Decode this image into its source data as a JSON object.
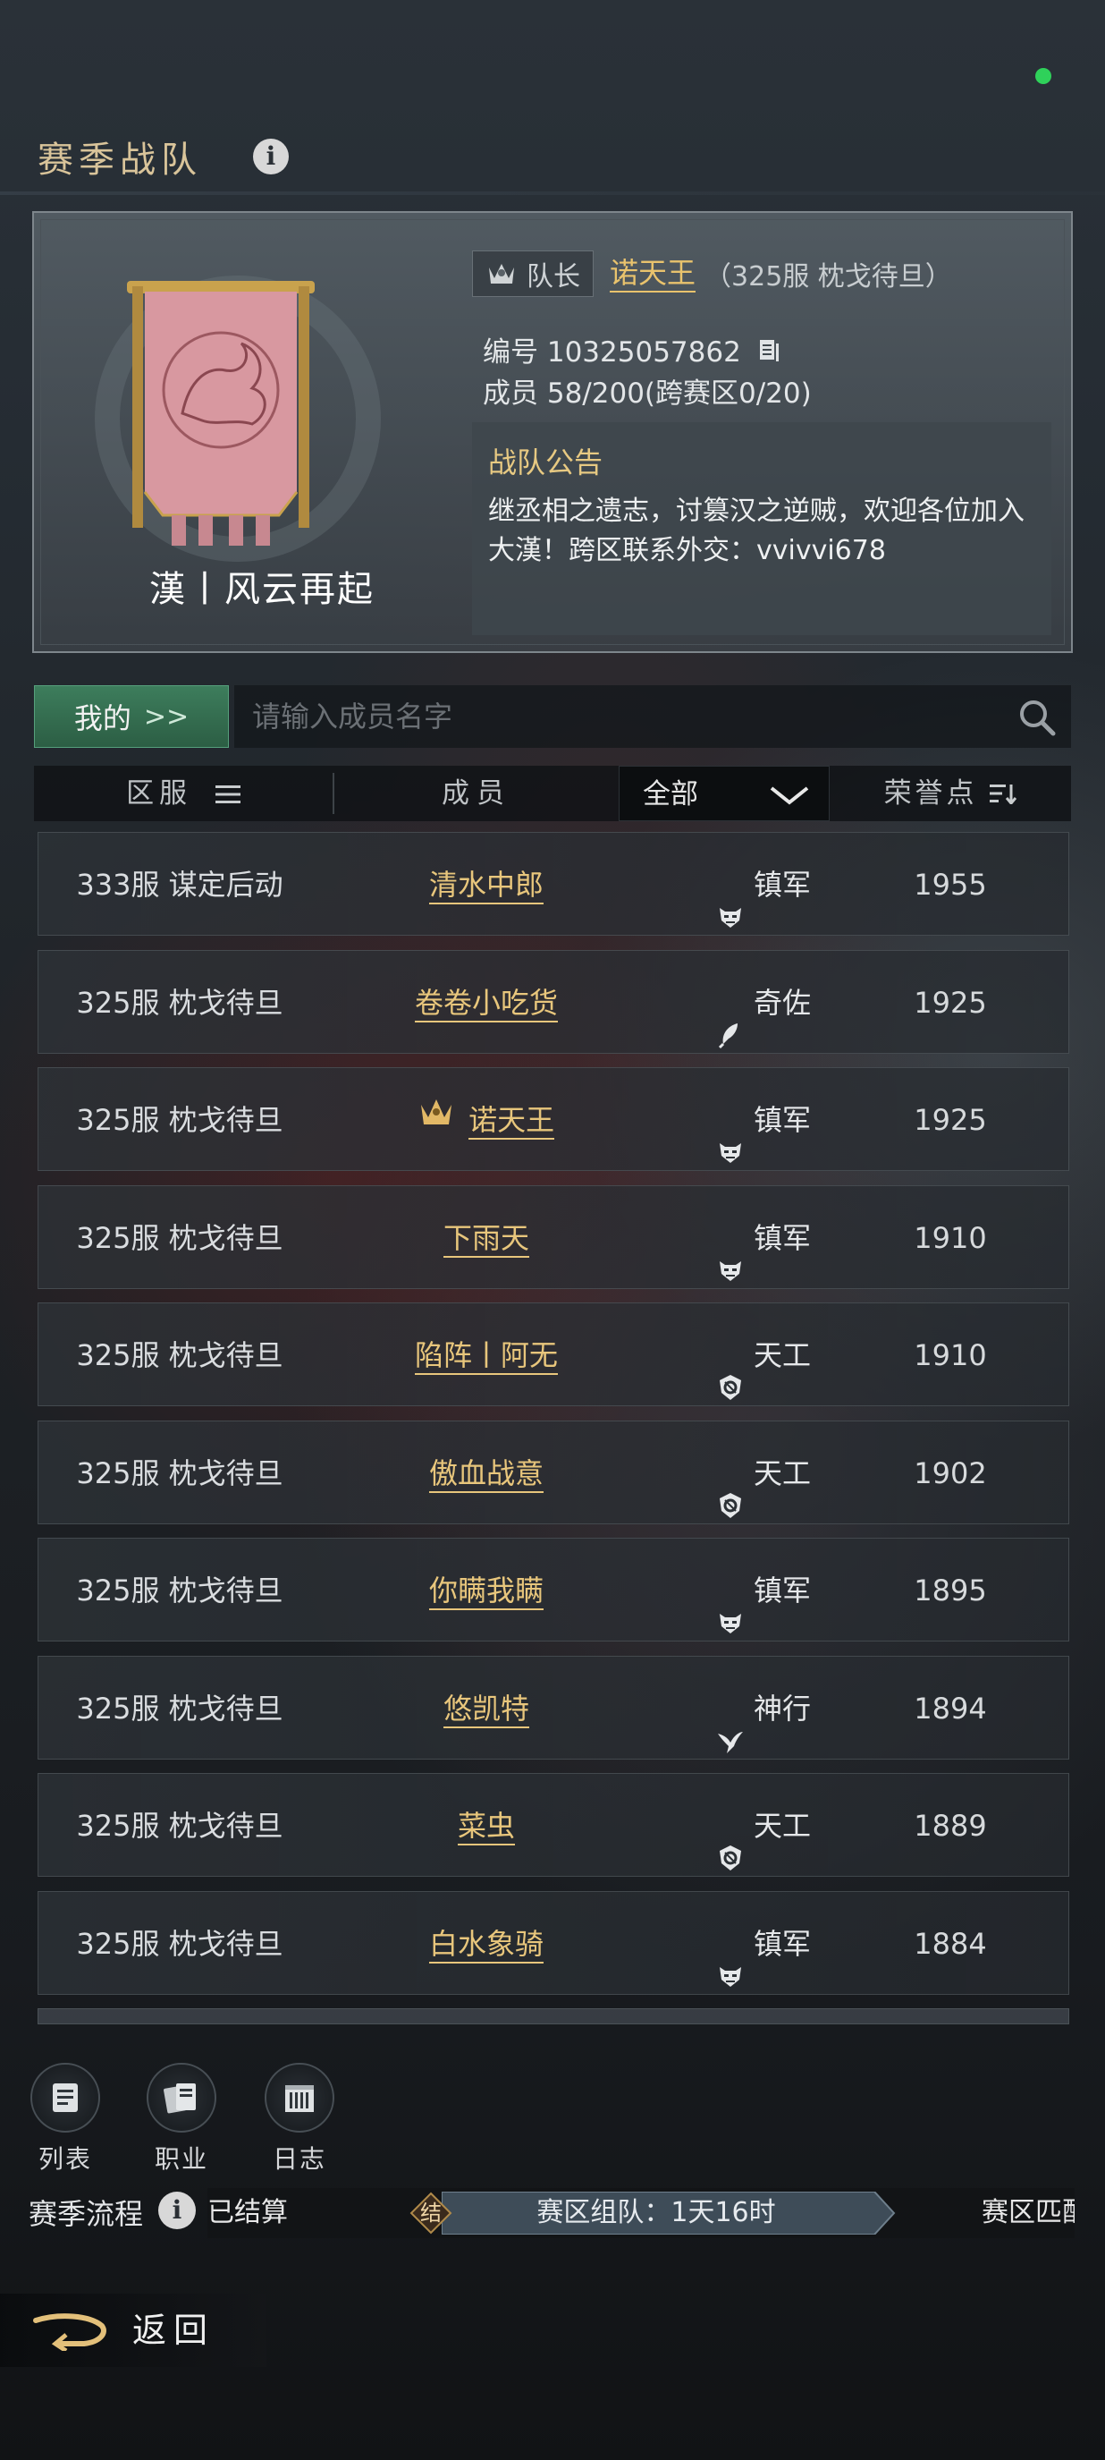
{
  "page": {
    "title": "赛季战队"
  },
  "team": {
    "name": "漢丨风云再起",
    "leader_label": "队长",
    "leader_name": "诺天王",
    "leader_server": "（325服 枕戈待旦）",
    "id_line": "编号 10325057862",
    "members_line": "成员 58/200(跨赛区0/20)",
    "notice_title": "战队公告",
    "notice_text": "继丞相之遗志，讨篡汉之逆贼，欢迎各位加入大漢！跨区联系外交：vvivvi678"
  },
  "search": {
    "mine_label": "我的",
    "placeholder": "请输入成员名字"
  },
  "header": {
    "server": "区服",
    "member": "成员",
    "filter": "全部",
    "honor": "荣誉点"
  },
  "members": [
    {
      "server": "333服 谋定后动",
      "name": "清水中郎",
      "cls": "镇军",
      "icon": "demon-mask-icon",
      "honor": "1955",
      "leader": false
    },
    {
      "server": "325服 枕戈待旦",
      "name": "卷卷小吃货",
      "cls": "奇佐",
      "icon": "feather-icon",
      "honor": "1925",
      "leader": false
    },
    {
      "server": "325服 枕戈待旦",
      "name": "诺天王",
      "cls": "镇军",
      "icon": "demon-mask-icon",
      "honor": "1925",
      "leader": true
    },
    {
      "server": "325服 枕戈待旦",
      "name": "下雨天",
      "cls": "镇军",
      "icon": "demon-mask-icon",
      "honor": "1910",
      "leader": false
    },
    {
      "server": "325服 枕戈待旦",
      "name": "陷阵丨阿无",
      "cls": "天工",
      "icon": "gear-shield-icon",
      "honor": "1910",
      "leader": false
    },
    {
      "server": "325服 枕戈待旦",
      "name": "傲血战意",
      "cls": "天工",
      "icon": "gear-shield-icon",
      "honor": "1902",
      "leader": false
    },
    {
      "server": "325服 枕戈待旦",
      "name": "你瞒我瞒",
      "cls": "镇军",
      "icon": "demon-mask-icon",
      "honor": "1895",
      "leader": false
    },
    {
      "server": "325服 枕戈待旦",
      "name": "悠凯特",
      "cls": "神行",
      "icon": "bird-icon",
      "honor": "1894",
      "leader": false
    },
    {
      "server": "325服 枕戈待旦",
      "name": "菜虫",
      "cls": "天工",
      "icon": "gear-shield-icon",
      "honor": "1889",
      "leader": false
    },
    {
      "server": "325服 枕戈待旦",
      "name": "白水象骑",
      "cls": "镇军",
      "icon": "demon-mask-icon",
      "honor": "1884",
      "leader": false
    }
  ],
  "tools": {
    "list": "列表",
    "job": "职业",
    "log": "日志"
  },
  "flow": {
    "label": "赛季流程",
    "prev": "已结算",
    "node": "结",
    "current": "赛区组队：1天16时",
    "next": "赛区匹配"
  },
  "back": {
    "label": "返回"
  },
  "colors": {
    "gold": "#e8c67c",
    "accent_green": "#3d7d5c",
    "status_online": "#2fd15a"
  }
}
